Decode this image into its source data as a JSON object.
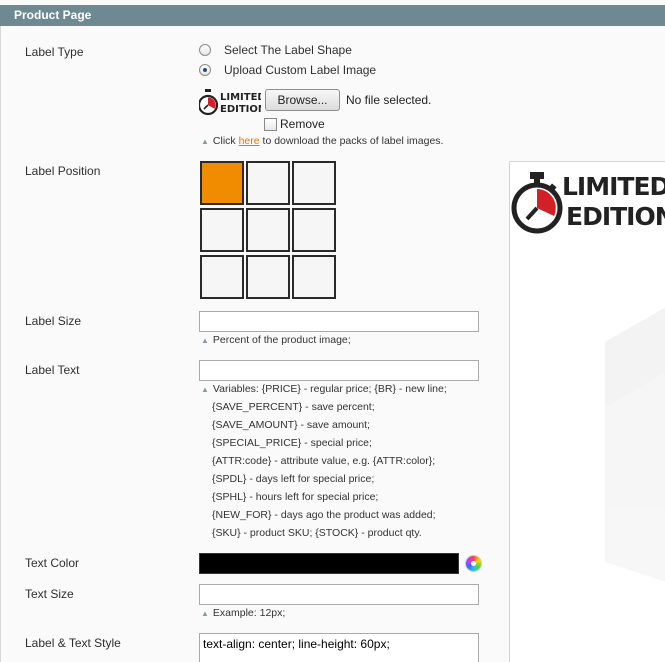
{
  "section": {
    "title": "Product Page"
  },
  "labels": {
    "label_type": "Label Type",
    "label_position": "Label Position",
    "label_size": "Label Size",
    "label_text": "Label Text",
    "text_color": "Text Color",
    "text_size": "Text Size",
    "label_text_style": "Label & Text Style"
  },
  "label_type": {
    "options": [
      {
        "label": "Select The Label Shape",
        "checked": false
      },
      {
        "label": "Upload Custom Label Image",
        "checked": true
      }
    ],
    "browse_label": "Browse...",
    "file_status": "No file selected.",
    "remove_label": "Remove",
    "stamp_text_line1": "LIMITED",
    "stamp_text_line2": "EDITION",
    "note_prefix": "Click",
    "note_link": "here",
    "note_suffix": "to download the packs of label images."
  },
  "label_position": {
    "selected_index": 0,
    "cells": 9
  },
  "label_size": {
    "value": "",
    "note": "Percent of the product image;"
  },
  "label_text": {
    "value": "",
    "notes": [
      "Variables: {PRICE} - regular price; {BR} - new line;",
      "{SAVE_PERCENT} - save percent;",
      "{SAVE_AMOUNT} - save amount;",
      "{SPECIAL_PRICE} - special price;",
      "{ATTR:code} - attribute value, e.g. {ATTR:color};",
      "{SPDL} - days left for special price;",
      "{SPHL} - hours left for special price;",
      "{NEW_FOR} - days ago the product was added;",
      "{SKU} - product SKU; {STOCK} - product qty."
    ]
  },
  "text_color": {
    "value": "#000000"
  },
  "text_size": {
    "value": "",
    "note": "Example: 12px;"
  },
  "label_text_style": {
    "value": "text-align: center; line-height: 60px;"
  },
  "preview": {
    "stamp_text_line1": "LIMITED",
    "stamp_text_line2": "EDITION"
  },
  "colors": {
    "header_bg": "#6f8992",
    "selected_cell": "#f18b00",
    "link": "#ea7601",
    "stamp_red": "#d32027"
  }
}
